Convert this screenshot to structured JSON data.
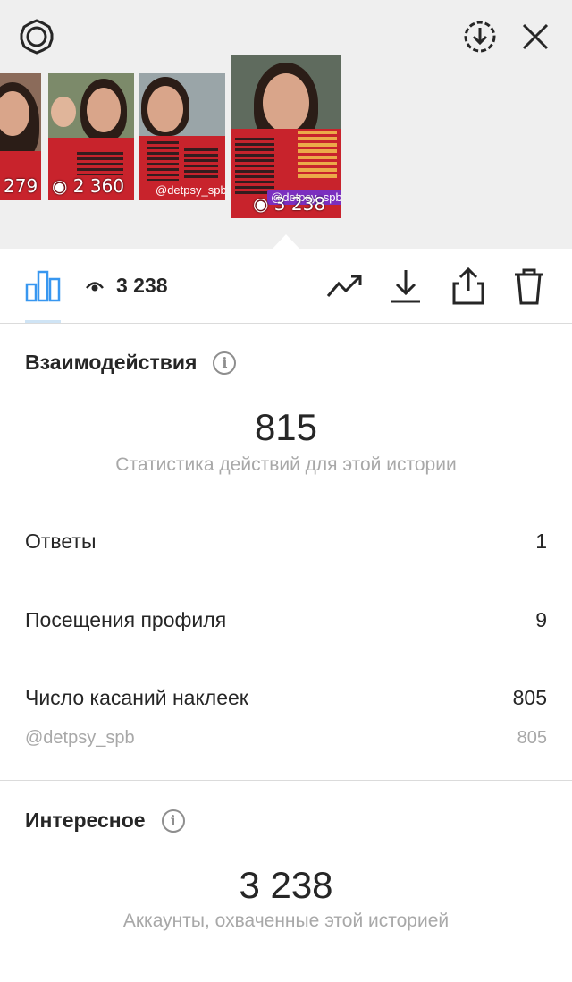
{
  "top_bar": {
    "settings_icon": "gear-icon",
    "download_circle_icon": "download-circle-icon",
    "close_icon": "close-icon"
  },
  "stories": [
    {
      "views": "279"
    },
    {
      "views": "2 360"
    },
    {
      "views": "",
      "tag": "@detpsy_spb"
    },
    {
      "views": "3 238",
      "tag": "@detpsy_spb",
      "selected": true
    }
  ],
  "toolbar": {
    "insights_tab_icon": "bar-chart-icon",
    "views_icon": "eye-icon",
    "views_count": "3 238",
    "promote_icon": "trend-up-icon",
    "save_icon": "download-icon",
    "share_icon": "share-icon",
    "delete_icon": "trash-icon"
  },
  "interactions": {
    "title": "Взаимодействия",
    "total": "815",
    "total_caption": "Статистика действий для этой истории",
    "rows": [
      {
        "label": "Ответы",
        "value": "1"
      },
      {
        "label": "Посещения профиля",
        "value": "9"
      },
      {
        "label": "Число касаний наклеек",
        "value": "805"
      }
    ],
    "sticker": {
      "label": "@detpsy_spb",
      "value": "805"
    }
  },
  "discovery": {
    "title": "Интересное",
    "total": "3 238",
    "total_caption": "Аккаунты, охваченные этой историей"
  },
  "colors": {
    "accent_blue": "#3897f0",
    "story_red": "#c8232c",
    "tag_purple": "#7b2fbf"
  }
}
